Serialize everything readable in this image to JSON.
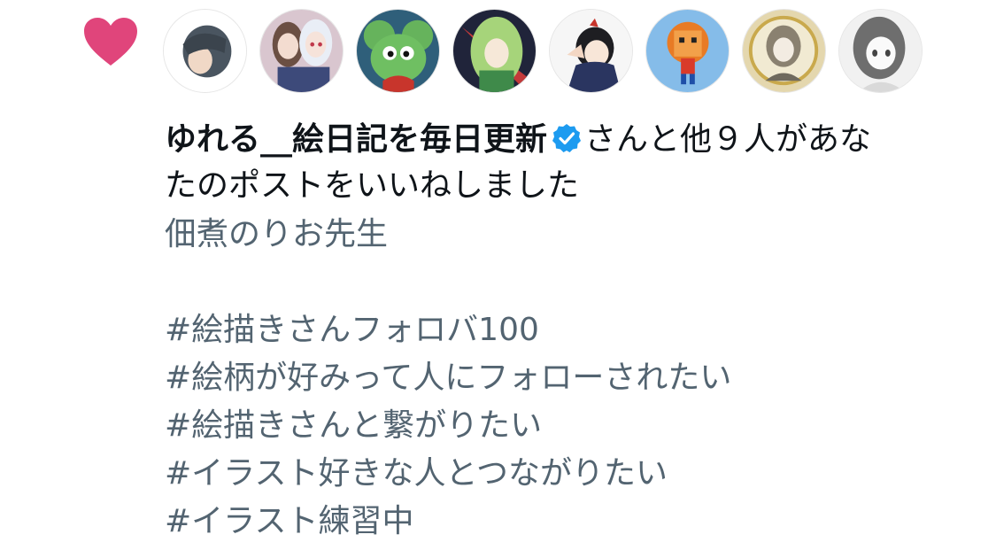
{
  "notification": {
    "icon": "heart-icon",
    "icon_color": "#E0457B",
    "avatars": [
      {
        "name": "avatar-1",
        "bg": "#ffffff"
      },
      {
        "name": "avatar-2",
        "bg": "#c9b8c8"
      },
      {
        "name": "avatar-3",
        "bg": "#4f8f4a"
      },
      {
        "name": "avatar-4",
        "bg": "#8fc47a"
      },
      {
        "name": "avatar-5",
        "bg": "#f3f3f3"
      },
      {
        "name": "avatar-6",
        "bg": "#7fb6e6"
      },
      {
        "name": "avatar-7",
        "bg": "#d8c9a0"
      },
      {
        "name": "avatar-8",
        "bg": "#eeeeee"
      }
    ],
    "user_name": "ゆれる__絵日記を毎日更新",
    "verified_icon": "verified-badge-icon",
    "verified_color": "#1D9BF0",
    "action_line1_suffix": "さんと他９人があな",
    "action_line2": "たのポストをいいねしました",
    "post_lines": [
      "佃煮のりお先生",
      "",
      "#絵描きさんフォロバ100",
      "#絵柄が好みって人にフォローされたい",
      "#絵描きさんと繋がりたい",
      "#イラスト好きな人とつながりたい",
      "#イラスト練習中"
    ]
  }
}
